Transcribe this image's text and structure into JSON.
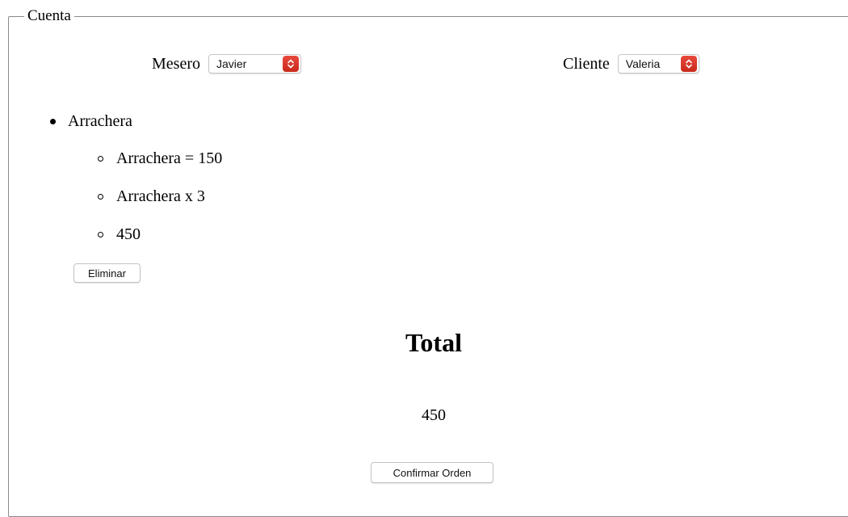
{
  "fieldset": {
    "legend": "Cuenta"
  },
  "mesero": {
    "label": "Mesero",
    "selected": "Javier"
  },
  "cliente": {
    "label": "Cliente",
    "selected": "Valeria"
  },
  "order_items": [
    {
      "name": "Arrachera",
      "details": [
        "Arrachera = 150",
        "Arrachera x 3",
        "450"
      ],
      "delete_label": "Eliminar"
    }
  ],
  "total": {
    "title": "Total",
    "value": "450"
  },
  "confirm_label": "Confirmar Orden",
  "colors": {
    "select_arrow": "#d93426",
    "border": "#8a8a8a"
  },
  "icons": {
    "select_arrow": "chevron-up-down-icon"
  }
}
